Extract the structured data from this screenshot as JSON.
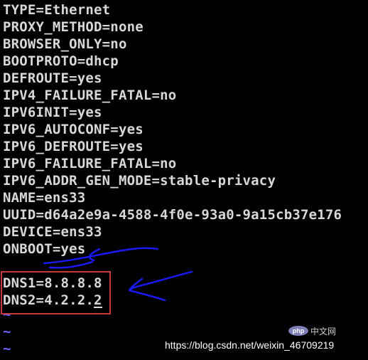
{
  "config_lines": [
    "TYPE=Ethernet",
    "PROXY_METHOD=none",
    "BROWSER_ONLY=no",
    "BOOTPROTO=dhcp",
    "DEFROUTE=yes",
    "IPV4_FAILURE_FATAL=no",
    "IPV6INIT=yes",
    "IPV6_AUTOCONF=yes",
    "IPV6_DEFROUTE=yes",
    "IPV6_FAILURE_FATAL=no",
    "IPV6_ADDR_GEN_MODE=stable-privacy",
    "NAME=ens33",
    "UUID=d64a2e9a-4588-4f0e-93a0-9a15cb37e176",
    "DEVICE=ens33",
    "ONBOOT=yes"
  ],
  "dns_lines": [
    "DNS1=8.8.8.8",
    "DNS2=4.2.2."
  ],
  "cursor_char": "2",
  "empty_line_marker": "~",
  "watermark": {
    "url": "https://blog.csdn.net/weixin_46709219",
    "logo_text": "php",
    "site_text": "中文网"
  },
  "colors": {
    "text": "#d8d8d8",
    "tilde": "#6a63ff",
    "highlight_box": "#c53a3a",
    "annotation_ink": "#1a1aff"
  }
}
